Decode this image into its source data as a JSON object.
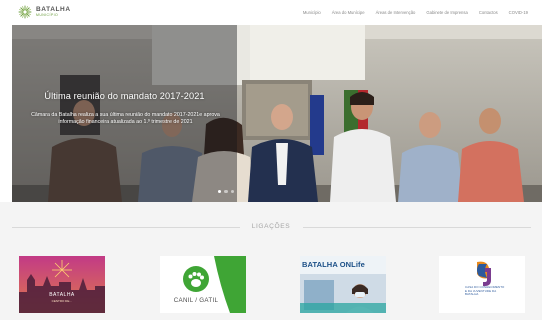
{
  "brand": {
    "name": "BATALHA",
    "subtitle": "MUNICÍPIO"
  },
  "nav": {
    "items": [
      "Município",
      "Área do Munícipe",
      "Áreas de Intervenção",
      "Gabinete de Imprensa",
      "Contactos",
      "COVID-19"
    ]
  },
  "hero": {
    "title": "Última reunião do mandato 2017-2021",
    "description": "Câmara da Batalha realiza a sua última reunião do mandato 2017-2021e aprova informação financeira atualizada ao 1.º trimestre de 2021",
    "slides_count": 3,
    "active_slide": 0
  },
  "links": {
    "section_title": "LIGAÇÕES",
    "cards": [
      {
        "title": "BATALHA",
        "subtitle": "CENTRO DE…"
      },
      {
        "title": "CANIL / GATIL"
      },
      {
        "title": "BATALHA ONLife"
      },
      {
        "title": "CASA DO CONHECIMENTO E DA JUVENTUDE DA BATALHA"
      }
    ]
  },
  "colors": {
    "brand_green": "#6a9c3c",
    "canil_green": "#3fa535",
    "onlife_blue": "#1b4f87",
    "casa_blue": "#2d5a9c",
    "casa_orange": "#e8891c"
  }
}
